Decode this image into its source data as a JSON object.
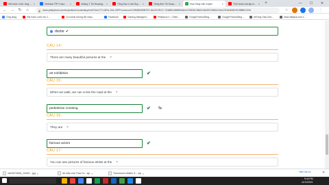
{
  "browser": {
    "tabs": [
      {
        "label": "Hài hước cười, lồng lộn...",
        "color": "#ff0000"
      },
      {
        "label": "VietJack.TRY Huzzmedia...",
        "color": "#1a73e8"
      },
      {
        "label": "Unikey 1 Tôi Hoaang...",
        "color": "#ff0000"
      },
      {
        "label": "Tổng Sao 1 của Suyagao...",
        "color": "#ff0000"
      },
      {
        "label": "Tiếng Anh Tôi Hoaang...",
        "color": "#ff0000"
      },
      {
        "label": "Hoa Hồng Hàn Xuyên",
        "color": "#34a853"
      },
      {
        "label": "Thời khoá của tạp mệ...",
        "color": "#ff0000"
      }
    ],
    "new_tab_label": "+",
    "window_controls": {
      "minimize": "—",
      "maximize": "☐",
      "close": "✕"
    },
    "nav": {
      "back": "←",
      "forward": "→",
      "reload": "↻",
      "home": "⌂"
    },
    "url": "www.pellyduck.com/en/pratice/vocabulary/ex/67AA1771-6EA-19A-25FFxxxxxxxx1C9B8D9/BB7EC-8ACE2ECC-7D88EA3B9B9AA/xCD3BDC6BA19ADE019BA12/AxCE3A4BDD9C8BBD1234",
    "bookmarks": [
      {
        "label": "Ứng dụng",
        "color": "#4285f4"
      },
      {
        "label": "Hài hước cười cho 1 ...",
        "color": "#ff0000"
      },
      {
        "label": "Cựu khát nhưng đội nhạc...",
        "color": "#ff0000"
      },
      {
        "label": "Facebook",
        "color": "#1877f2"
      },
      {
        "label": "Gaming Managem...",
        "color": "#ff0000"
      },
      {
        "label": "Pellyduck 4 - Chiền...",
        "color": "#ff0000"
      },
      {
        "label": "Google/Yahoo/Bing...",
        "color": "#5f6368"
      },
      {
        "label": "Google/Yahoo/Bing ...",
        "color": "#5f6368"
      },
      {
        "label": "AKKing Giao Scri...",
        "color": "#5f6368"
      },
      {
        "label": "www.vietjack.com 1...",
        "color": "#5f6368"
      }
    ]
  },
  "quiz": {
    "first_answer": "doctor",
    "check_symbol": "✔",
    "questions": [
      {
        "number_label": "CÂU 14:",
        "prompt": "There are many beautiful pictures at the",
        "qmark": "?",
        "answer": "art exhibition"
      },
      {
        "number_label": "CÂU 15:",
        "prompt": "When we walk, we can cross the road at the",
        "qmark": "?",
        "answer": "pedestrian crossing"
      },
      {
        "number_label": "CÂU 16:",
        "prompt": "They are",
        "qmark": "?",
        "answer": "famous actors"
      },
      {
        "number_label": "CÂU 17:",
        "prompt": "You can see pictures of famous artists at the",
        "qmark": "?"
      }
    ]
  },
  "downloads": [
    {
      "name": "1604972608_13449....jpg"
    },
    {
      "name": "tải mẫu của Thực hi....zip"
    },
    {
      "name": "Tomorrow's Maths S....zip"
    }
  ],
  "downloads_show_all": "Hiện tất cả",
  "downloads_close": "✕",
  "taskbar": {
    "tray_time": "9:44 PM",
    "tray_date": "11/11/2021",
    "accent_colors": [
      "#f4b400",
      "#e8453c",
      "#4285f4",
      "#ffffff",
      "#0f9d58",
      "#c62828",
      "#1565c0",
      "#43a047",
      "#1e88e5",
      "#ffffff"
    ]
  }
}
